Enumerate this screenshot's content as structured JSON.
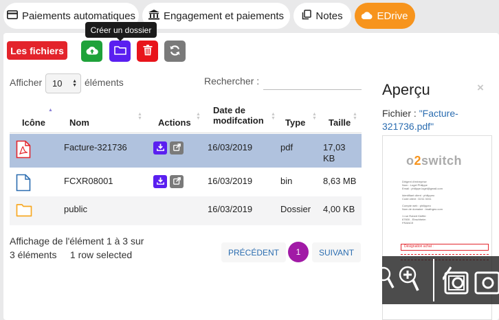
{
  "tabs": [
    {
      "label": "Paiements automatiques",
      "icon": "credit-card-icon",
      "active": false
    },
    {
      "label": "Engagement et paiements",
      "icon": "bank-icon",
      "active": false
    },
    {
      "label": "Notes",
      "icon": "notes-icon",
      "active": false
    },
    {
      "label": "EDrive",
      "icon": "cloud-icon",
      "active": true
    }
  ],
  "toolbar": {
    "files_label": "Les fichiers",
    "tooltip": "Créer un dossier",
    "buttons": [
      "upload-cloud-icon",
      "folder-icon",
      "trash-icon",
      "refresh-icon"
    ]
  },
  "table_controls": {
    "show_prefix": "Afficher",
    "page_length": "10",
    "show_suffix": "éléments",
    "search_label": "Rechercher :",
    "search_value": ""
  },
  "table": {
    "headers": {
      "icon": "Icône",
      "name": "Nom",
      "actions": "Actions",
      "date_line1": "Date de",
      "date_line2": "modifcation",
      "type": "Type",
      "size": "Taille"
    },
    "rows": [
      {
        "icon": "pdf-file-icon",
        "name": "Facture-321736",
        "has_actions": true,
        "date": "16/03/2019",
        "type": "pdf",
        "size_line1": "17,03",
        "size_line2": "KB",
        "selected": true
      },
      {
        "icon": "file-icon",
        "name": "FCXR08001",
        "has_actions": true,
        "date": "16/03/2019",
        "type": "bin",
        "size_line1": "8,63 MB",
        "size_line2": "",
        "selected": false
      },
      {
        "icon": "folder-icon",
        "name": "public",
        "has_actions": false,
        "date": "16/03/2019",
        "type": "Dossier",
        "size_line1": "4,00 KB",
        "size_line2": "",
        "selected": false
      }
    ]
  },
  "footer": {
    "info_line1": "Affichage de l'élément 1 à 3 sur",
    "info_line2": "3 éléments     1 row selected",
    "prev": "PRÉCÉDENT",
    "page": "1",
    "next": "SUIVANT"
  },
  "preview": {
    "title": "Aperçu",
    "close": "×",
    "file_label": "Fichier : ",
    "file_name": "\"Facture-321736.pdf\"",
    "doc": {
      "logo_left": "o",
      "logo_mid": "2",
      "logo_right": "switch",
      "lines": [
        "Dirigent d'entreprise",
        "Nom : Logel Philippe",
        "Email : philippe.logel@gmail.com",
        "",
        "Identifiant client : philippeo",
        "Code client : D211 0241",
        "",
        "Compte web : philippeo",
        "Nom de domaine : imathgeo.com",
        "",
        "1 rue Robert Kieffer",
        "67600 - Ebschheim",
        "FRANCE"
      ],
      "designation": "Désignation achat :"
    }
  },
  "colors": {
    "accent_orange": "#f7941d",
    "danger_red": "#e3242b",
    "purple": "#5a1ff0",
    "green": "#1fa23a",
    "gray": "#7a7a7a",
    "selected_row": "#b0c2de",
    "pager_active": "#a11aa6",
    "link_blue": "#2a6cb0"
  }
}
